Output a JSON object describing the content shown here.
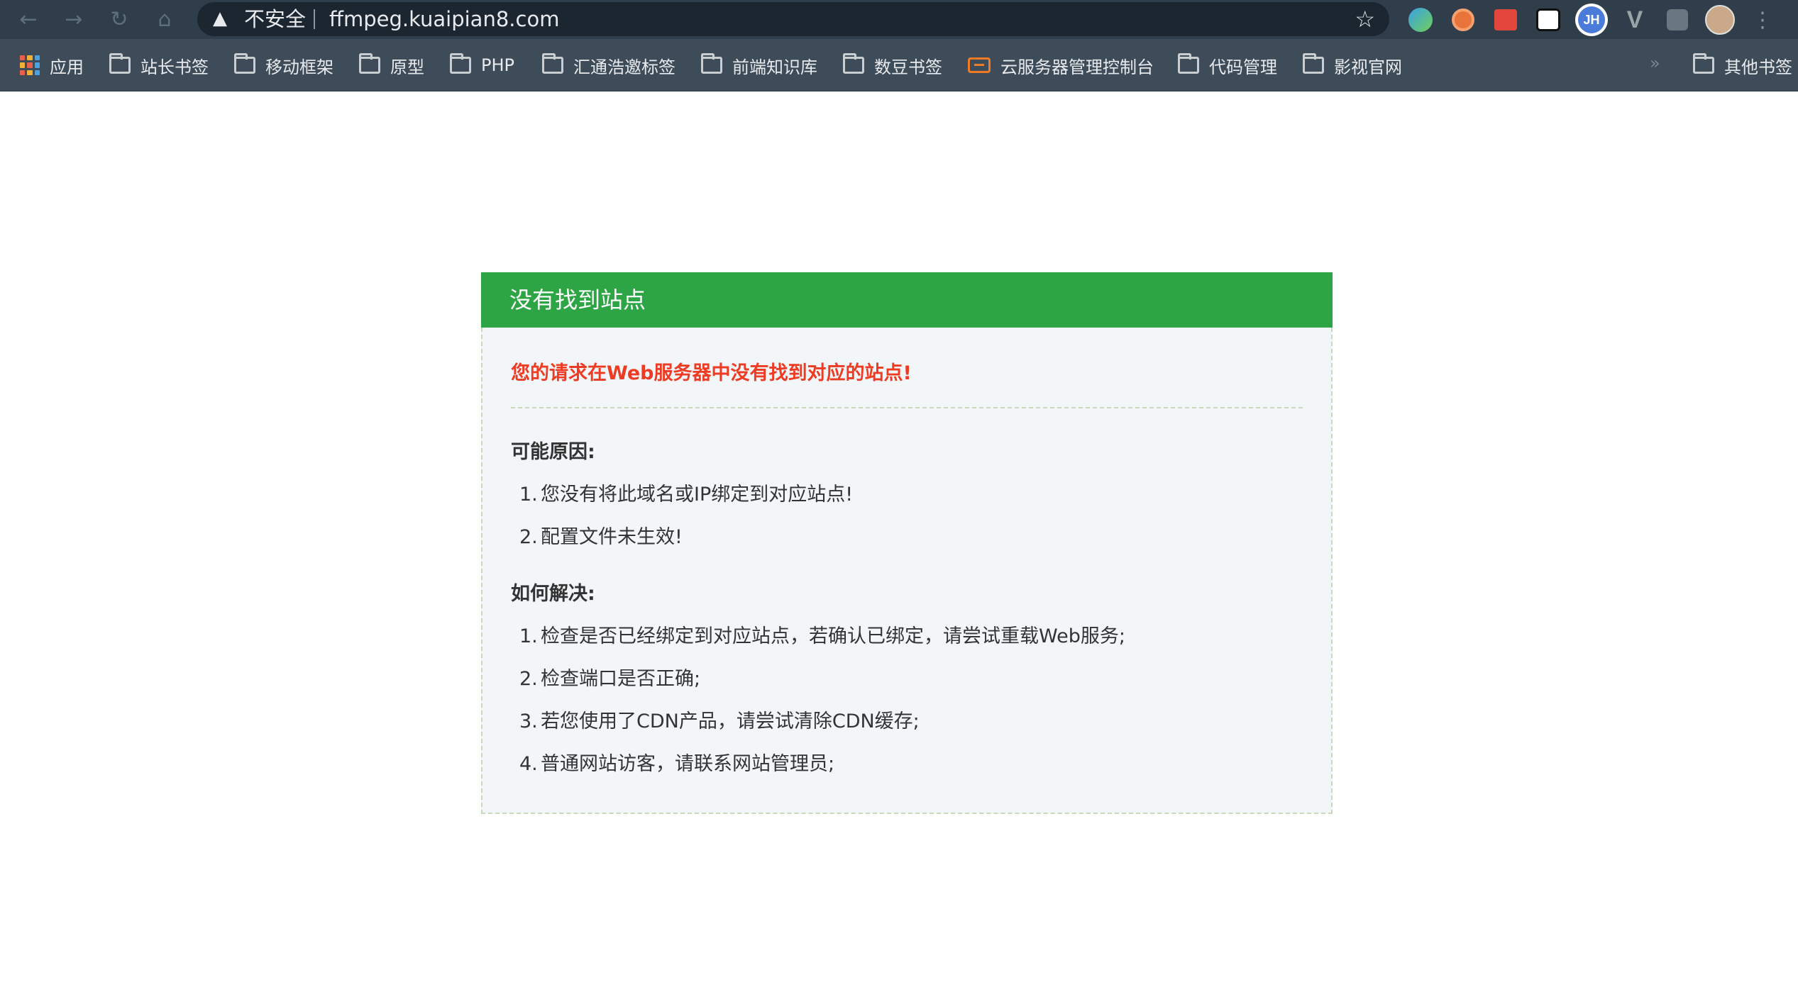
{
  "browser": {
    "security_label": "不安全",
    "url": "ffmpeg.kuaipian8.com",
    "ext_jh_label": "JH",
    "ext_v_label": "V"
  },
  "bookmarks": {
    "apps_label": "应用",
    "items": [
      "站长书签",
      "移动框架",
      "原型",
      "PHP",
      "汇通浩邀标签",
      "前端知识库",
      "数豆书签",
      "云服务器管理控制台",
      "代码管理",
      "影视官网"
    ],
    "overflow": "»",
    "other_label": "其他书签"
  },
  "panel": {
    "title": "没有找到站点",
    "error": "您的请求在Web服务器中没有找到对应的站点!",
    "reasons_title": "可能原因:",
    "reasons": [
      "您没有将此域名或IP绑定到对应站点!",
      "配置文件未生效!"
    ],
    "solutions_title": "如何解决:",
    "solutions": [
      "检查是否已经绑定到对应站点，若确认已绑定，请尝试重载Web服务;",
      "检查端口是否正确;",
      "若您使用了CDN产品，请尝试清除CDN缓存;",
      "普通网站访客，请联系网站管理员;"
    ],
    "numbers": [
      "1.",
      "2.",
      "3.",
      "4."
    ]
  },
  "colors": {
    "header_green": "#2ea544",
    "error_red": "#ee3c24",
    "panel_bg": "#f2f6f8"
  }
}
